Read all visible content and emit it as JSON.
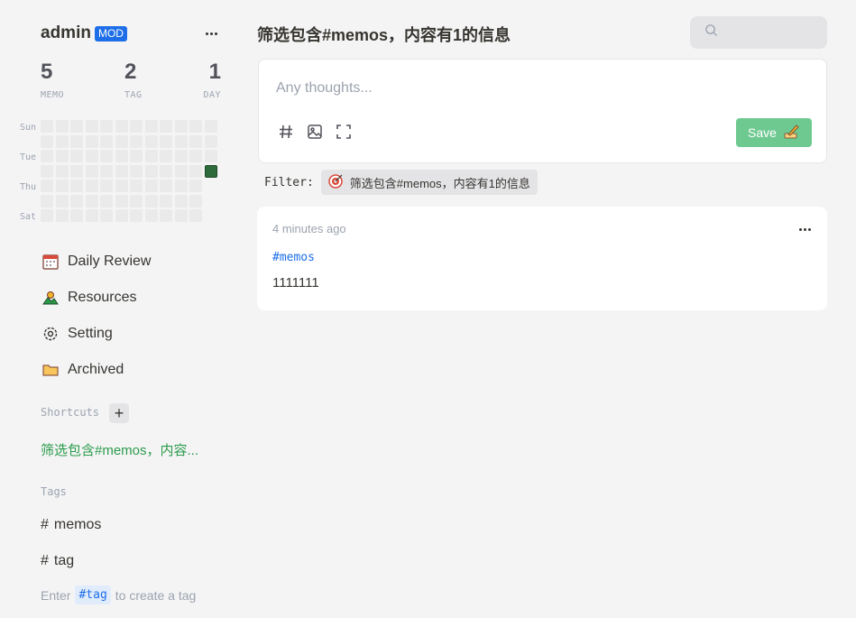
{
  "user": {
    "name": "admin",
    "role_badge": "MOD"
  },
  "stats": [
    {
      "value": "5",
      "label": "MEMO"
    },
    {
      "value": "2",
      "label": "TAG"
    },
    {
      "value": "1",
      "label": "DAY"
    }
  ],
  "heatmap": {
    "day_labels": [
      "Sun",
      "Tue",
      "Thu",
      "Sat"
    ],
    "active_color": "#2d6b3c"
  },
  "nav": {
    "items": [
      {
        "label": "Daily Review",
        "icon": "calendar-icon"
      },
      {
        "label": "Resources",
        "icon": "image-gallery-icon"
      },
      {
        "label": "Setting",
        "icon": "gear-icon"
      },
      {
        "label": "Archived",
        "icon": "folder-icon"
      }
    ]
  },
  "shortcuts": {
    "title": "Shortcuts",
    "items": [
      "筛选包含#memos，内容..."
    ]
  },
  "tags": {
    "title": "Tags",
    "items": [
      "memos",
      "tag"
    ]
  },
  "tip": {
    "before": "Enter",
    "chip": "#tag",
    "after": "to create a tag"
  },
  "header": {
    "title": "筛选包含#memos，内容有1的信息"
  },
  "search": {
    "placeholder": ""
  },
  "editor": {
    "placeholder": "Any thoughts...",
    "save_label": "Save"
  },
  "filter": {
    "label": "Filter:",
    "value": "筛选包含#memos，内容有1的信息"
  },
  "memos": [
    {
      "time": "4 minutes ago",
      "tag": "#memos",
      "content": "1111111"
    }
  ],
  "colors": {
    "accent_green": "#6ec991",
    "shortcut_green": "#2b9b4b",
    "badge_blue": "#1d6ee8"
  }
}
